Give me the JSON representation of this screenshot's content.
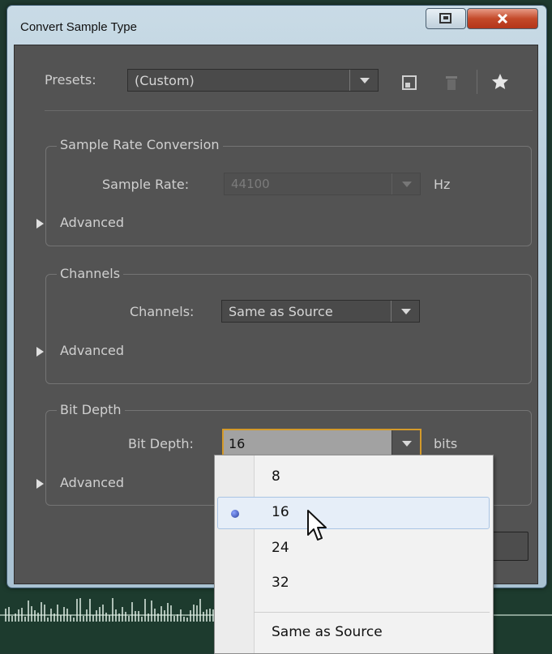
{
  "window": {
    "title": "Convert Sample Type"
  },
  "presets": {
    "label": "Presets:",
    "value": "(Custom)"
  },
  "sample_rate_section": {
    "legend": "Sample Rate Conversion",
    "label": "Sample Rate:",
    "value": "44100",
    "unit": "Hz",
    "advanced": "Advanced"
  },
  "channels_section": {
    "legend": "Channels",
    "label": "Channels:",
    "value": "Same as Source",
    "advanced": "Advanced"
  },
  "bit_depth_section": {
    "legend": "Bit Depth",
    "label": "Bit Depth:",
    "value": "16",
    "unit": "bits",
    "advanced": "Advanced"
  },
  "bit_depth_options": [
    "8",
    "16",
    "24",
    "32",
    "Same as Source"
  ],
  "selected_option": "16",
  "colors": {
    "panel": "#535353",
    "accent_border": "#d49a2a",
    "close_red": "#c44a2a"
  },
  "icons": [
    "save-preset-icon",
    "delete-preset-icon",
    "favorite-star-icon",
    "restore-icon",
    "close-icon",
    "mouse-cursor-icon"
  ]
}
